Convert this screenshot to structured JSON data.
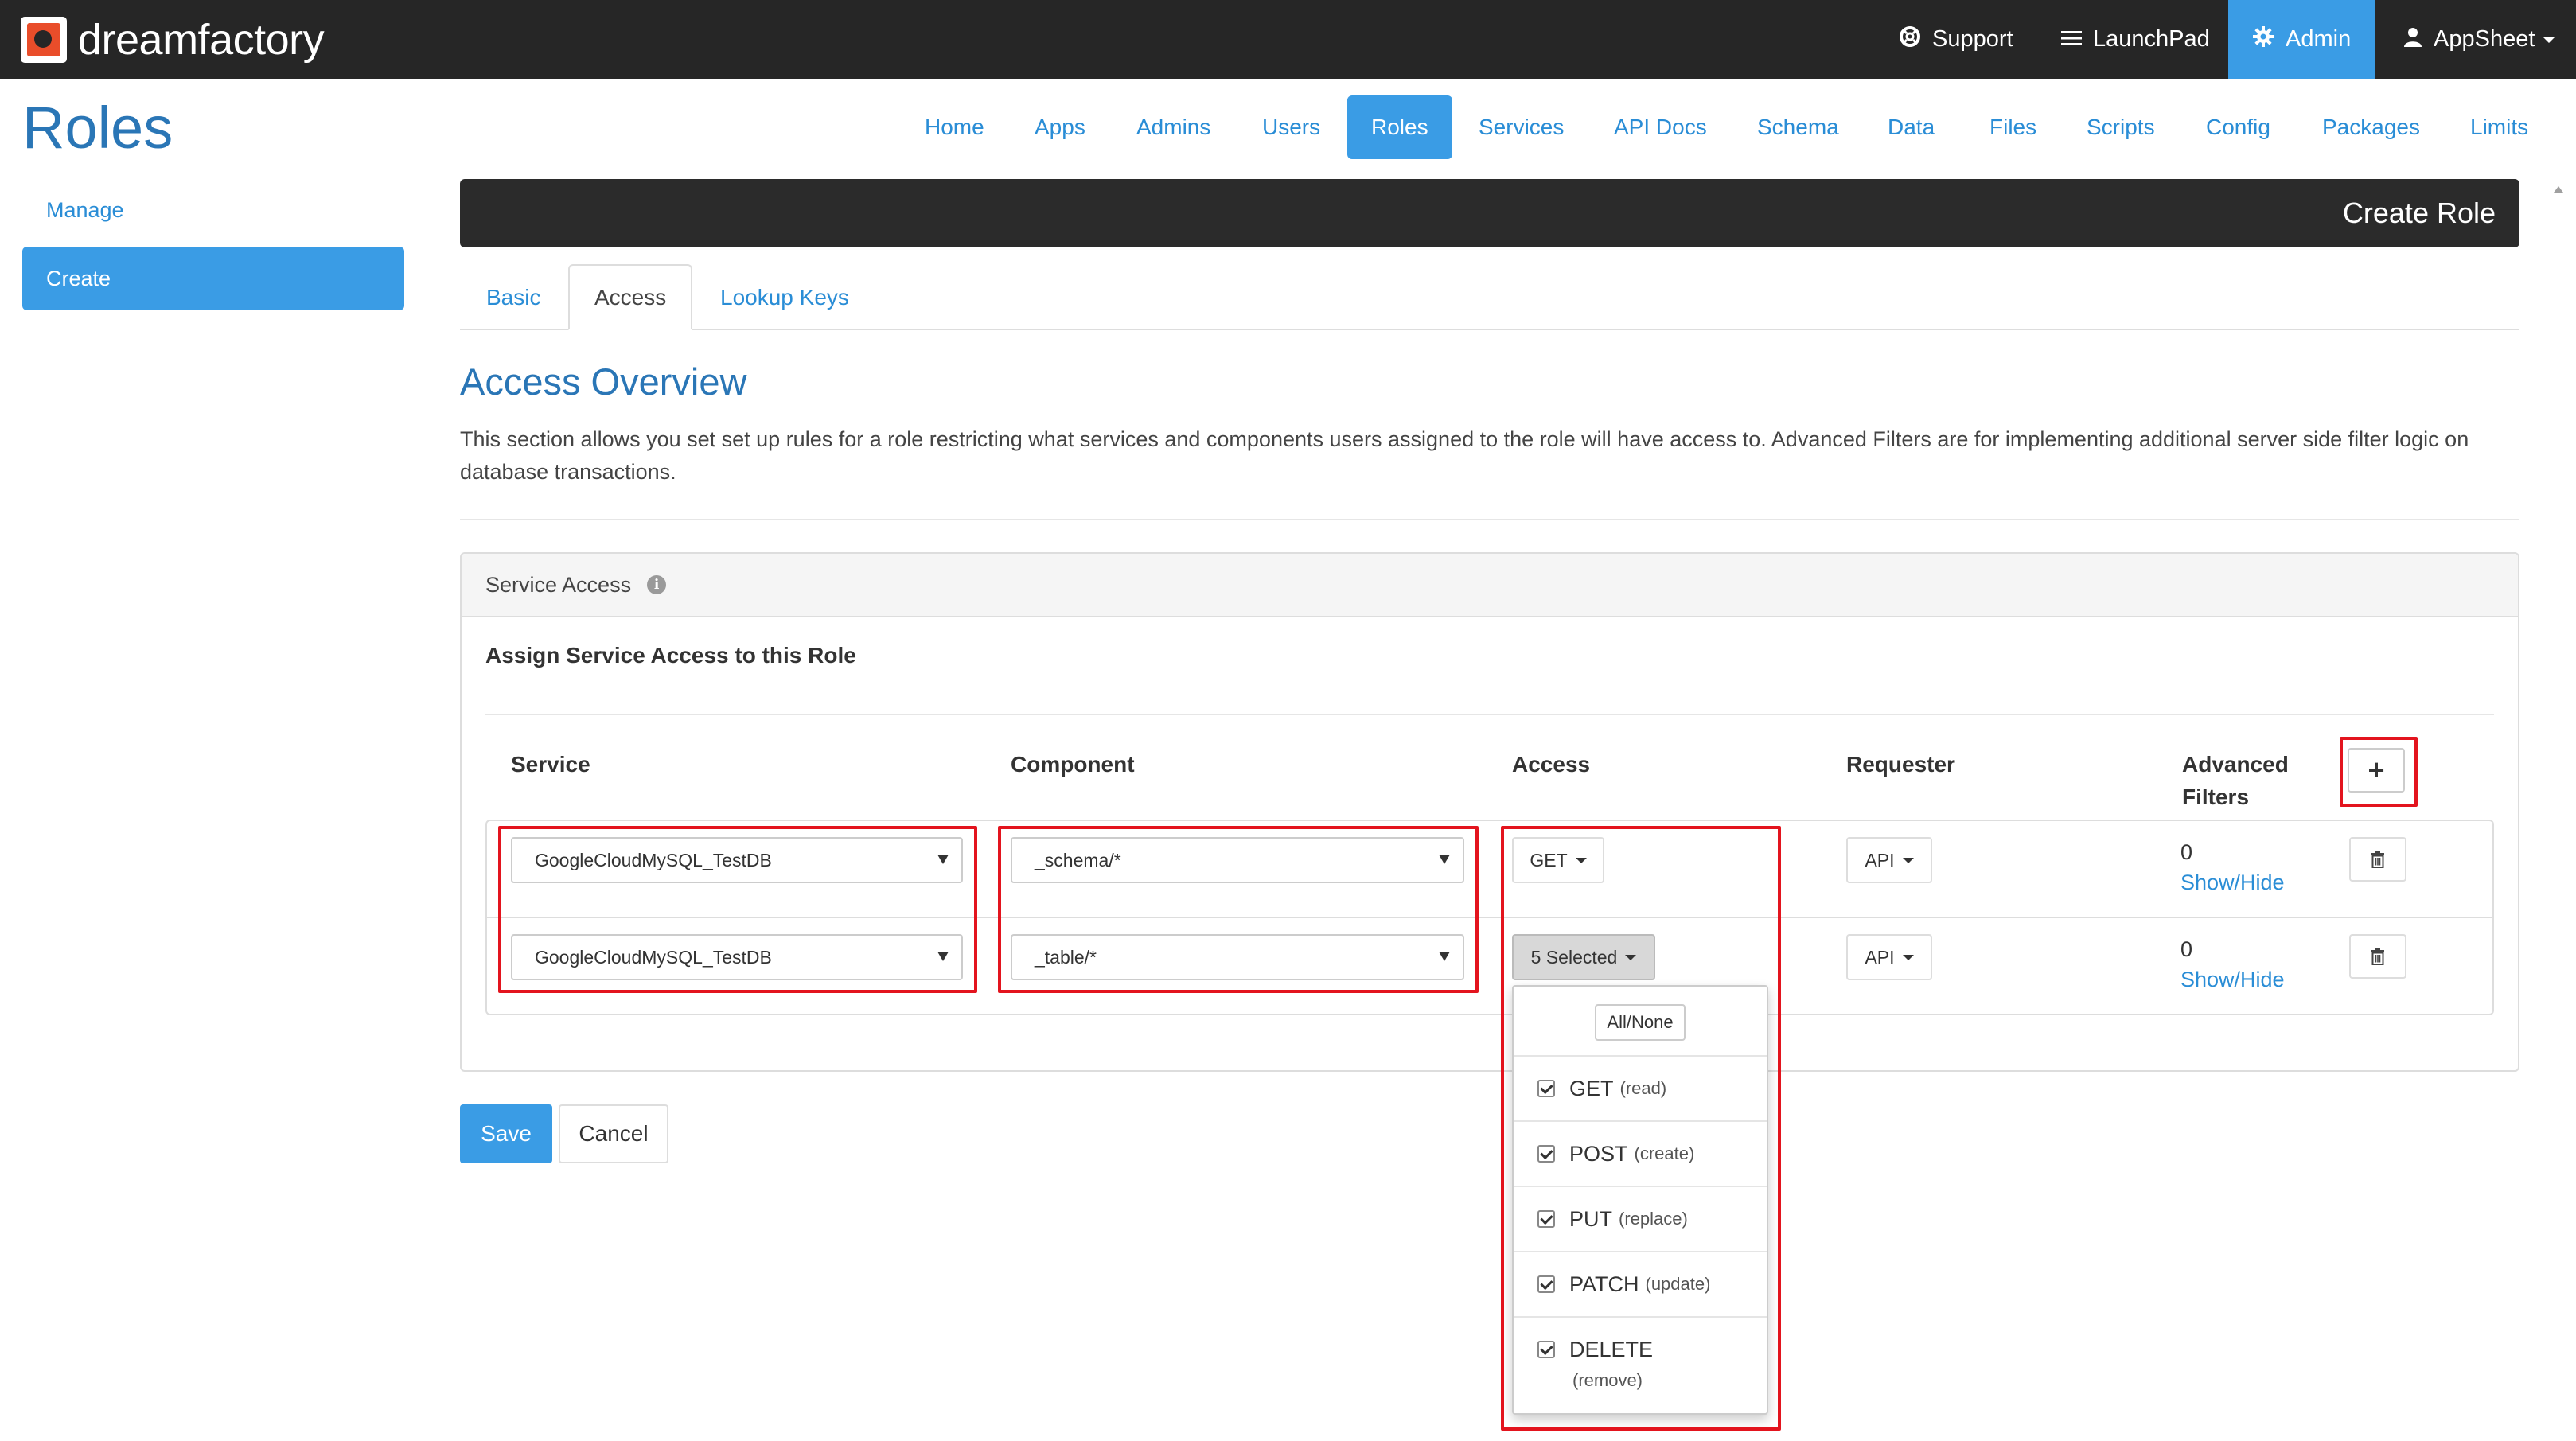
{
  "app": {
    "brand": "dreamfactory"
  },
  "topnav": {
    "support": "Support",
    "launchpad": "LaunchPad",
    "admin": "Admin",
    "user": "AppSheet"
  },
  "page": {
    "title": "Roles"
  },
  "subnav": {
    "items": [
      "Home",
      "Apps",
      "Admins",
      "Users",
      "Roles",
      "Services",
      "API Docs",
      "Schema",
      "Data",
      "Files",
      "Scripts",
      "Config",
      "Packages",
      "Limits"
    ],
    "active": "Roles"
  },
  "sidebar": {
    "items": [
      "Manage",
      "Create"
    ],
    "active": "Create"
  },
  "header_bar": {
    "title": "Create Role"
  },
  "tabs": {
    "items": [
      "Basic",
      "Access",
      "Lookup Keys"
    ],
    "active": "Access"
  },
  "overview": {
    "title": "Access Overview",
    "description": "This section allows you set set up rules for a role restricting what services and components users assigned to the role will have access to. Advanced Filters are for implementing additional server side filter logic on database transactions."
  },
  "service_access": {
    "panel_title": "Service Access",
    "subtitle": "Assign Service Access to this Role",
    "columns": {
      "service": "Service",
      "component": "Component",
      "access": "Access",
      "requester": "Requester",
      "advanced_filters": "Advanced Filters"
    },
    "add_label": "+",
    "rows": [
      {
        "service": "GoogleCloudMySQL_TestDB",
        "component": "_schema/*",
        "access": "GET",
        "requester": "API",
        "filter_count": "0",
        "filter_link": "Show/Hide"
      },
      {
        "service": "GoogleCloudMySQL_TestDB",
        "component": "_table/*",
        "access": "5 Selected",
        "requester": "API",
        "filter_count": "0",
        "filter_link": "Show/Hide"
      }
    ]
  },
  "access_dropdown": {
    "all_none": "All/None",
    "options": [
      {
        "verb": "GET",
        "desc": "(read)",
        "checked": true
      },
      {
        "verb": "POST",
        "desc": "(create)",
        "checked": true
      },
      {
        "verb": "PUT",
        "desc": "(replace)",
        "checked": true
      },
      {
        "verb": "PATCH",
        "desc": "(update)",
        "checked": true
      },
      {
        "verb": "DELETE",
        "desc": "(remove)",
        "checked": true
      }
    ]
  },
  "actions": {
    "save": "Save",
    "cancel": "Cancel"
  },
  "colors": {
    "accent": "#3a9ce5",
    "navbar": "#262626",
    "highlight": "#e3141e"
  }
}
